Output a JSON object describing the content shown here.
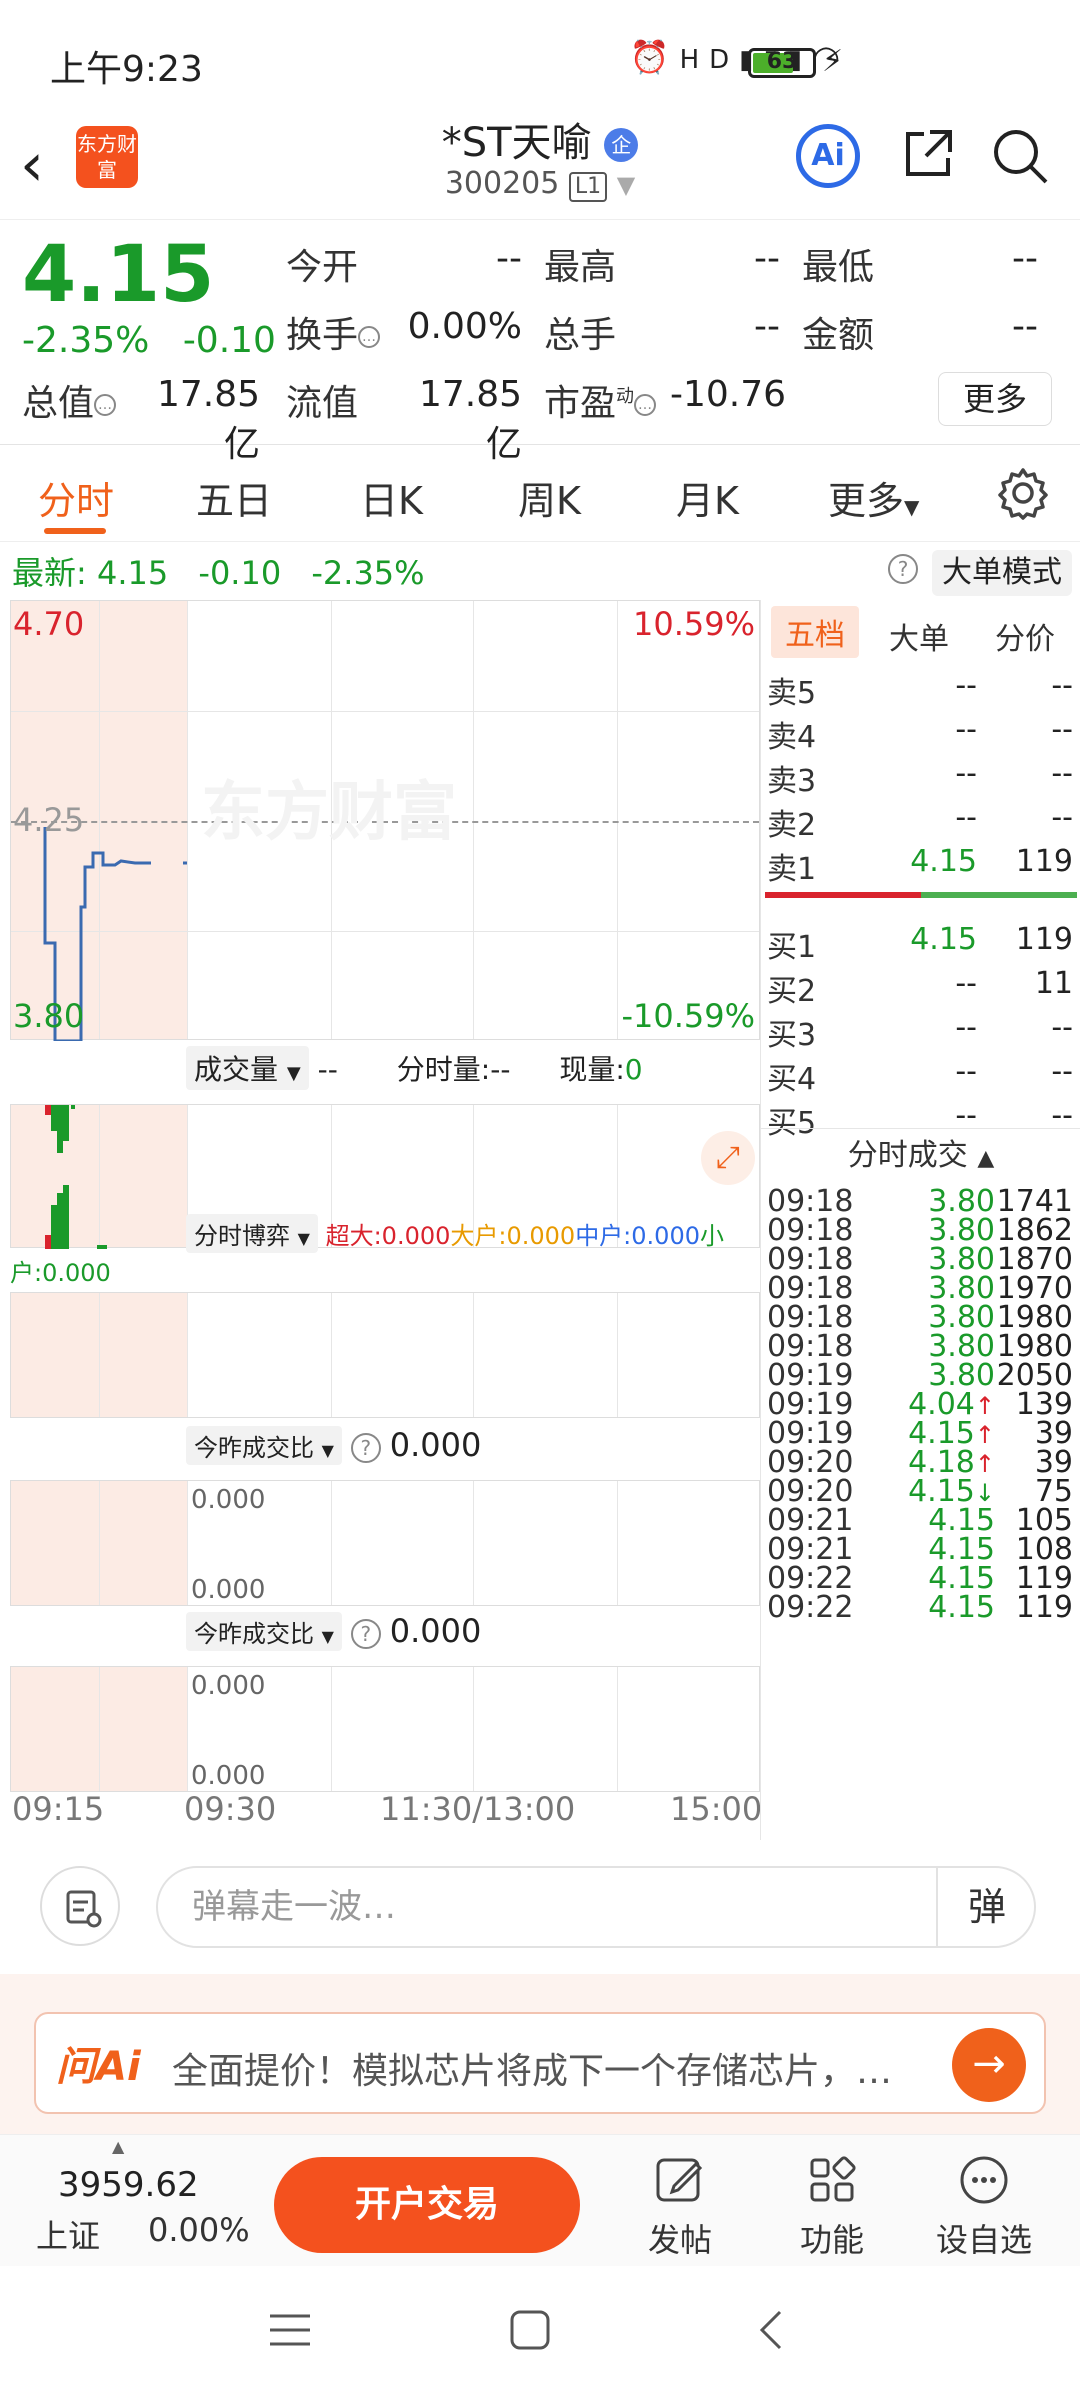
{
  "status": {
    "time": "上午9:23",
    "battery": "63"
  },
  "header": {
    "logo_text": "东方财富",
    "title": "*ST天喻",
    "title_badge": "企",
    "code": "300205",
    "level": "L1"
  },
  "quote": {
    "price": "4.15",
    "change_pct": "-2.35%",
    "change": "-0.10",
    "fields": {
      "open_label": "今开",
      "open": "--",
      "high_label": "最高",
      "high": "--",
      "low_label": "最低",
      "low": "--",
      "turnover_label": "换手",
      "turnover": "0.00%",
      "volume_label": "总手",
      "volume": "--",
      "amount_label": "金额",
      "amount": "--",
      "mktcap_label": "总值",
      "mktcap": "17.85亿",
      "float_label": "流值",
      "float": "17.85亿",
      "pe_label": "市盈",
      "pe_sup": "动",
      "pe": "-10.76"
    },
    "more": "更多"
  },
  "tabs": [
    "分时",
    "五日",
    "日K",
    "周K",
    "月K",
    "更多"
  ],
  "latest": {
    "label": "最新:",
    "price": "4.15",
    "change": "-0.10",
    "pct": "-2.35%",
    "help": "?",
    "mode_btn": "大单模式"
  },
  "chart": {
    "y_top": "4.70",
    "y_mid": "4.25",
    "y_bot": "3.80",
    "pct_top": "10.59%",
    "pct_bot": "-10.59%",
    "watermark": "东方财富",
    "vol_bar": {
      "dropdown": "成交量",
      "val": "--",
      "fenshi_label": "分时量:",
      "fenshi_val": "--",
      "cur_label": "现量:",
      "cur_val": "0"
    },
    "game_bar": {
      "dropdown": "分时博弈",
      "super": "超大:0.000",
      "big": "大户:0.000",
      "mid": "中户:0.000",
      "small": "小户:0.000"
    },
    "ratio1": {
      "dropdown": "今昨成交比",
      "help": "?",
      "val": "0.000",
      "top": "0.000",
      "bot": "0.000"
    },
    "ratio2": {
      "dropdown": "今昨成交比",
      "help": "?",
      "val": "0.000",
      "top": "0.000",
      "bot": "0.000"
    },
    "x_labels": [
      "09:15",
      "09:30",
      "11:30/13:00",
      "15:00"
    ]
  },
  "book": {
    "tabs": [
      "五档",
      "大单",
      "分价"
    ],
    "asks": [
      {
        "label": "卖5",
        "price": "--",
        "vol": "--"
      },
      {
        "label": "卖4",
        "price": "--",
        "vol": "--"
      },
      {
        "label": "卖3",
        "price": "--",
        "vol": "--"
      },
      {
        "label": "卖2",
        "price": "--",
        "vol": "--"
      },
      {
        "label": "卖1",
        "price": "4.15",
        "vol": "119"
      }
    ],
    "bids": [
      {
        "label": "买1",
        "price": "4.15",
        "vol": "119"
      },
      {
        "label": "买2",
        "price": "--",
        "vol": "11"
      },
      {
        "label": "买3",
        "price": "--",
        "vol": "--"
      },
      {
        "label": "买4",
        "price": "--",
        "vol": "--"
      },
      {
        "label": "买5",
        "price": "--",
        "vol": "--"
      }
    ],
    "trade_title": "分时成交",
    "trades": [
      {
        "t": "09:18",
        "p": "3.80",
        "arrow": "",
        "v": "1741"
      },
      {
        "t": "09:18",
        "p": "3.80",
        "arrow": "",
        "v": "1862"
      },
      {
        "t": "09:18",
        "p": "3.80",
        "arrow": "",
        "v": "1870"
      },
      {
        "t": "09:18",
        "p": "3.80",
        "arrow": "",
        "v": "1970"
      },
      {
        "t": "09:18",
        "p": "3.80",
        "arrow": "",
        "v": "1980"
      },
      {
        "t": "09:18",
        "p": "3.80",
        "arrow": "",
        "v": "1980"
      },
      {
        "t": "09:19",
        "p": "3.80",
        "arrow": "",
        "v": "2050"
      },
      {
        "t": "09:19",
        "p": "4.04",
        "arrow": "↑",
        "v": "139"
      },
      {
        "t": "09:19",
        "p": "4.15",
        "arrow": "↑",
        "v": "39"
      },
      {
        "t": "09:20",
        "p": "4.18",
        "arrow": "↑",
        "v": "39"
      },
      {
        "t": "09:20",
        "p": "4.15",
        "arrow": "↓",
        "v": "75"
      },
      {
        "t": "09:21",
        "p": "4.15",
        "arrow": "",
        "v": "105"
      },
      {
        "t": "09:21",
        "p": "4.15",
        "arrow": "",
        "v": "108"
      },
      {
        "t": "09:22",
        "p": "4.15",
        "arrow": "",
        "v": "119"
      },
      {
        "t": "09:22",
        "p": "4.15",
        "arrow": "",
        "v": "119"
      }
    ]
  },
  "comment": {
    "placeholder": "弹幕走一波…",
    "danmu_btn": "弹"
  },
  "ai_bar": {
    "logo": "问Ai",
    "text": "全面提价！模拟芯片将成下一个存储芯片，…",
    "go": "→"
  },
  "bottom": {
    "index_value": "3959.62",
    "index_name": "上证",
    "index_change": "0.00%",
    "trade_btn": "开户交易",
    "items": [
      "发帖",
      "功能",
      "设自选"
    ]
  },
  "colors": {
    "accent": "#f0611b",
    "up": "#d9232d",
    "down": "#1a9a2a",
    "line": "#3a6ab0"
  }
}
